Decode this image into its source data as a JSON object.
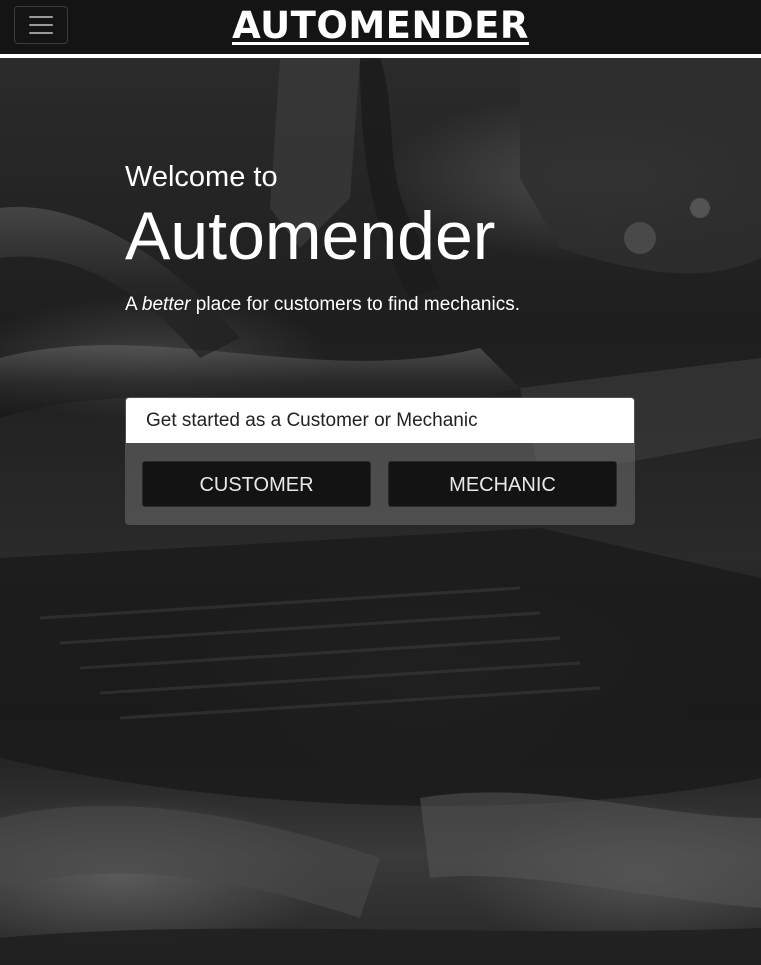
{
  "navbar": {
    "brand": "AUTOMENDER",
    "toggle_icon": "hamburger-menu-icon"
  },
  "hero": {
    "welcome": "Welcome to",
    "title": "Automender",
    "tagline_prefix": "A ",
    "tagline_emphasis": "better",
    "tagline_suffix": " place for customers to find mechanics."
  },
  "get_started": {
    "header": "Get started as a Customer or Mechanic",
    "customer_label": "CUSTOMER",
    "mechanic_label": "MECHANIC"
  },
  "colors": {
    "navbar_bg": "#141414",
    "button_bg": "#131313",
    "text_light": "#ffffff"
  }
}
